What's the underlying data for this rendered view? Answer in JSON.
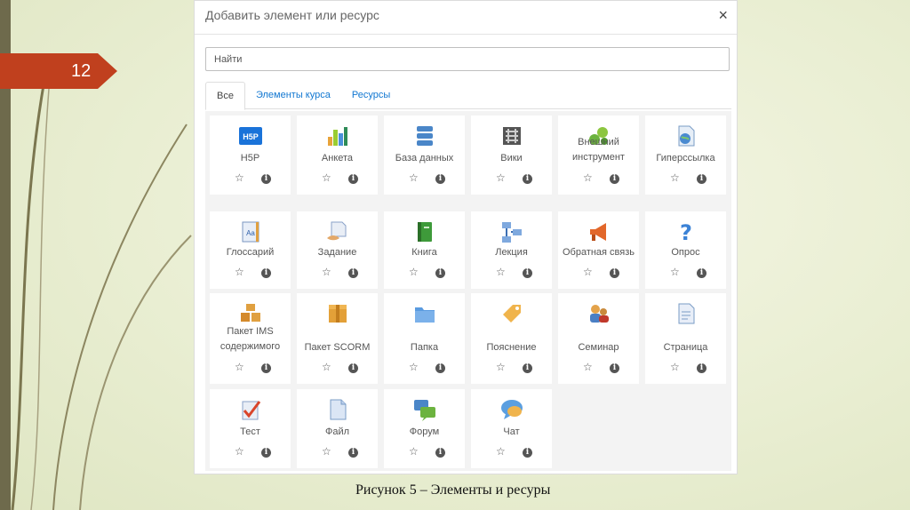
{
  "slide": {
    "number": "12",
    "caption": "Рисунок 5 – Элементы и ресуры"
  },
  "dialog": {
    "title": "Добавить элемент или ресурс",
    "close_label": "×",
    "search": {
      "placeholder": "Найти",
      "value": ""
    },
    "tabs": [
      {
        "label": "Все",
        "active": true
      },
      {
        "label": "Элементы курса",
        "active": false
      },
      {
        "label": "Ресурсы",
        "active": false
      }
    ],
    "items": [
      {
        "label": "H5P",
        "icon": "h5p-icon"
      },
      {
        "label": "Анкета",
        "icon": "bar-chart-icon"
      },
      {
        "label": "База данных",
        "icon": "database-icon"
      },
      {
        "label": "Вики",
        "icon": "wiki-icon"
      },
      {
        "label": "Внешний инструмент",
        "icon": "puzzle-icon"
      },
      {
        "label": "Гиперссылка",
        "icon": "globe-link-icon"
      },
      {
        "label": "Глоссарий",
        "icon": "glossary-icon"
      },
      {
        "label": "Задание",
        "icon": "assignment-icon"
      },
      {
        "label": "Книга",
        "icon": "book-icon"
      },
      {
        "label": "Лекция",
        "icon": "flowchart-icon"
      },
      {
        "label": "Обратная связь",
        "icon": "megaphone-icon"
      },
      {
        "label": "Опрос",
        "icon": "question-icon"
      },
      {
        "label": "Пакет IMS содержимого",
        "icon": "ims-package-icon"
      },
      {
        "label": "Пакет SCORM",
        "icon": "box-icon"
      },
      {
        "label": "Папка",
        "icon": "folder-icon"
      },
      {
        "label": "Пояснение",
        "icon": "tag-icon"
      },
      {
        "label": "Семинар",
        "icon": "workshop-icon"
      },
      {
        "label": "Страница",
        "icon": "page-icon"
      },
      {
        "label": "Тест",
        "icon": "quiz-icon"
      },
      {
        "label": "Файл",
        "icon": "file-icon"
      },
      {
        "label": "Форум",
        "icon": "forum-icon"
      },
      {
        "label": "Чат",
        "icon": "chat-icon"
      }
    ],
    "star_glyph": "☆",
    "info_glyph": "i"
  }
}
